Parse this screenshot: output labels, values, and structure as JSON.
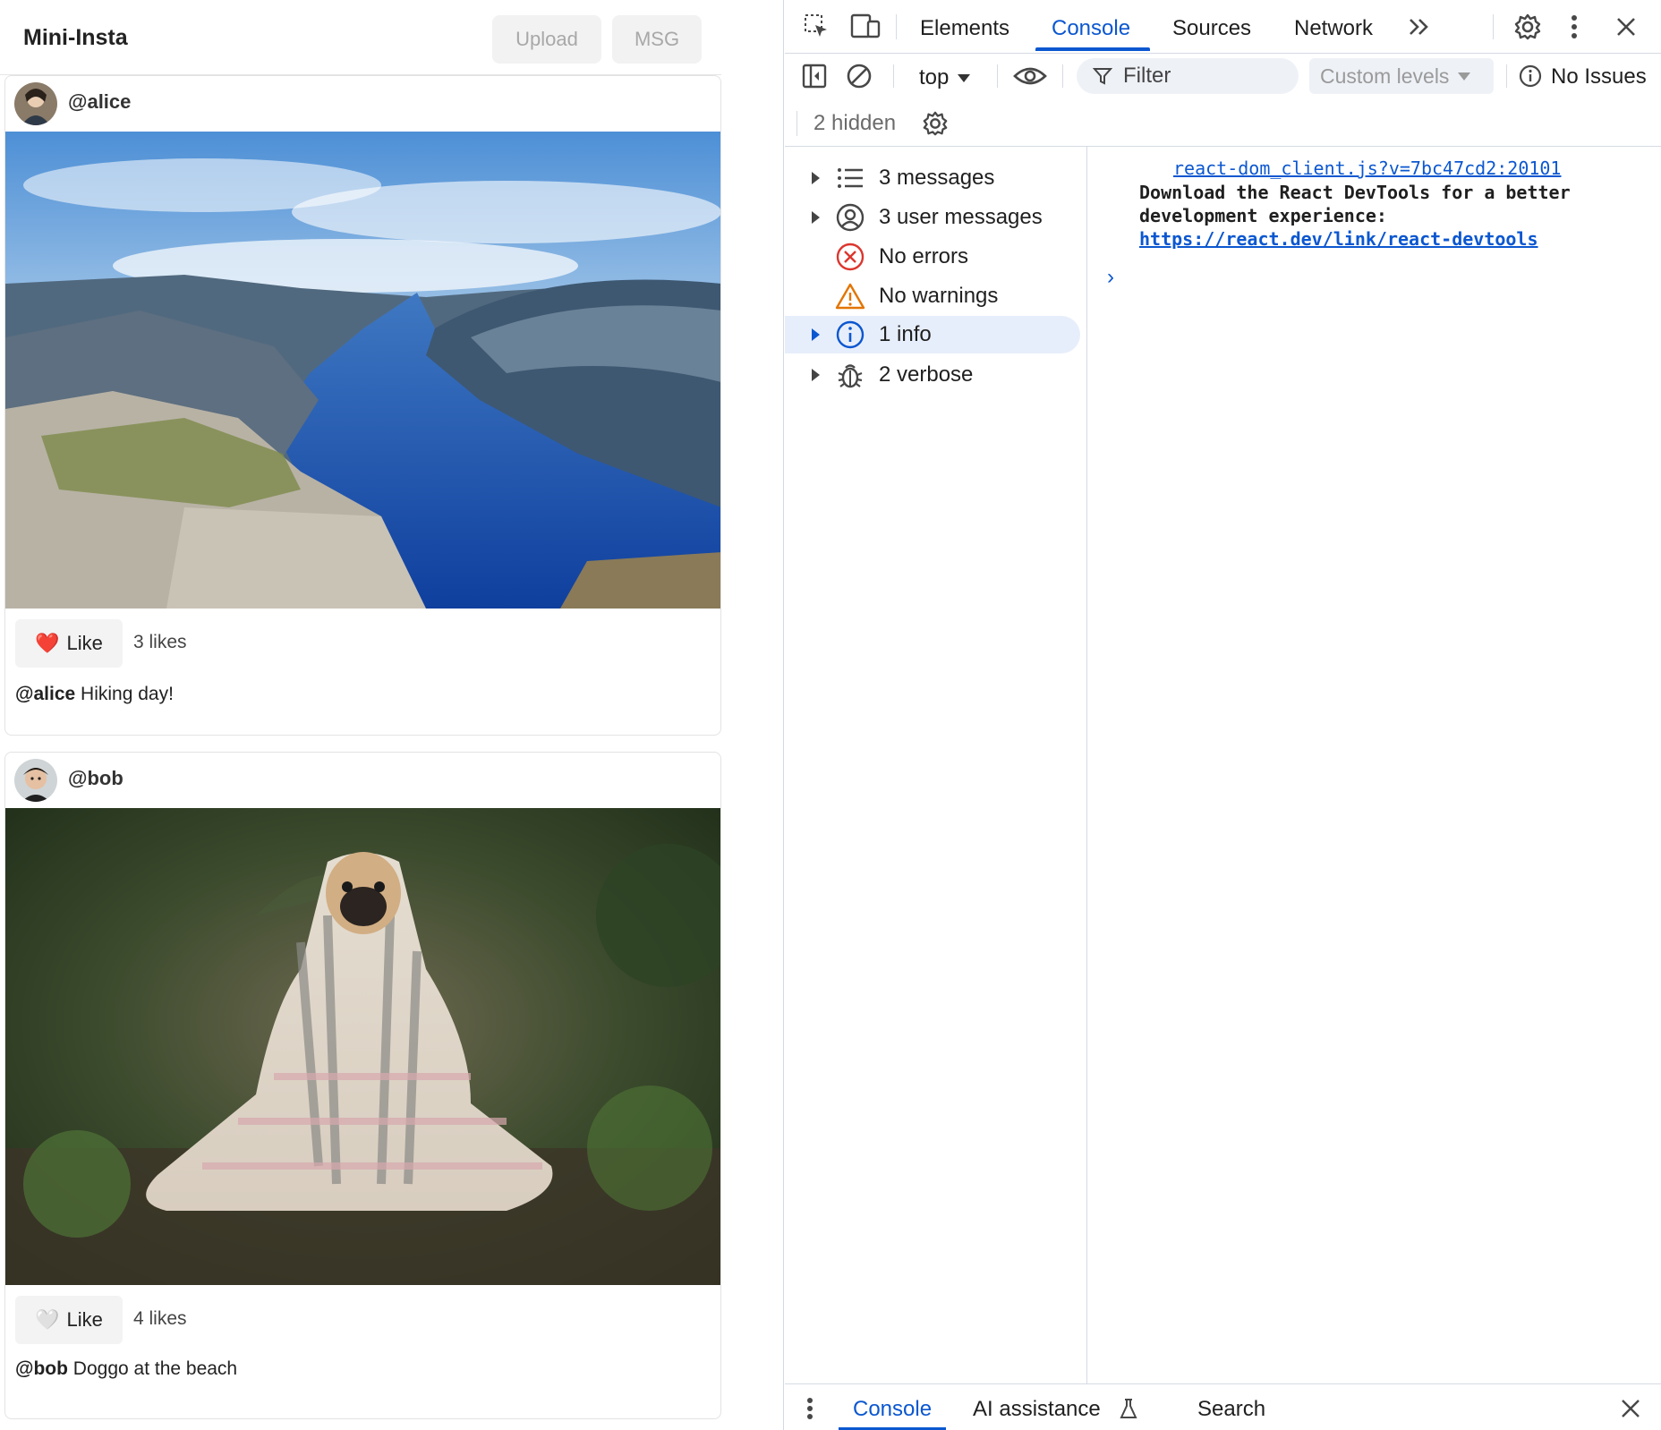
{
  "app": {
    "title": "Mini-Insta",
    "upload_label": "Upload",
    "msg_label": "MSG",
    "posts": [
      {
        "username": "@alice",
        "like_emoji": "❤️",
        "like_label": "Like",
        "likes": "3 likes",
        "caption_user": "@alice",
        "caption_text": " Hiking day!",
        "liked": true
      },
      {
        "username": "@bob",
        "like_emoji": "🤍",
        "like_label": "Like",
        "likes": "4 likes",
        "caption_user": "@bob",
        "caption_text": " Doggo at the beach",
        "liked": false
      }
    ]
  },
  "devtools": {
    "tabs": [
      "Elements",
      "Console",
      "Sources",
      "Network"
    ],
    "active_tab": "Console",
    "context": "top",
    "filter_placeholder": "Filter",
    "levels": "Custom levels",
    "issues": "No Issues",
    "hidden": "2 hidden",
    "sidebar": [
      {
        "label": "3 messages",
        "icon": "list-icon",
        "expandable": true,
        "selected": false
      },
      {
        "label": "3 user messages",
        "icon": "user-circle-icon",
        "expandable": true,
        "selected": false
      },
      {
        "label": "No errors",
        "icon": "error-icon",
        "expandable": false,
        "selected": false
      },
      {
        "label": "No warnings",
        "icon": "warning-icon",
        "expandable": false,
        "selected": false
      },
      {
        "label": "1 info",
        "icon": "info-icon",
        "expandable": true,
        "selected": true
      },
      {
        "label": "2 verbose",
        "icon": "bug-icon",
        "expandable": true,
        "selected": false
      }
    ],
    "console": {
      "source_link": "react-dom_client.js?v=7bc47cd2:20101",
      "message_line1": "Download the React DevTools for a better",
      "message_line2": "development experience:",
      "message_link": "https://react.dev/link/react-devtools",
      "prompt": "›"
    },
    "drawer": {
      "tabs": [
        "Console",
        "AI assistance",
        "Search"
      ],
      "active": "Console"
    },
    "colors": {
      "accent": "#0b57d0",
      "error": "#dc362e",
      "warning": "#e37400"
    }
  }
}
